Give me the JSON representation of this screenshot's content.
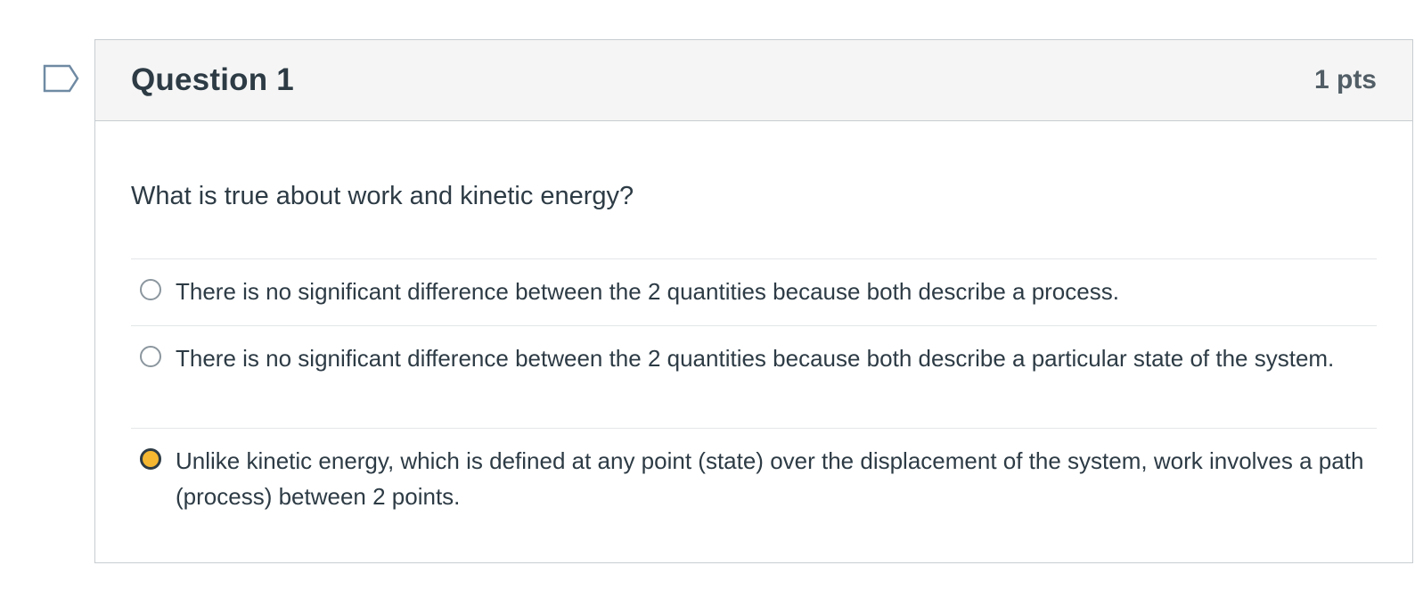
{
  "question": {
    "title": "Question 1",
    "points": "1 pts",
    "text": "What is true about work and kinetic energy?",
    "flag_icon": "flag-question-icon",
    "answers": [
      {
        "label": "There is no significant difference between the 2 quantities because both describe a process.",
        "selected": false
      },
      {
        "label": "There is no significant difference between the 2 quantities because both describe a particular state of the system.",
        "selected": false
      },
      {
        "label": "Unlike kinetic energy, which is defined at any point (state) over the displacement of the system, work involves a path (process) between 2 points.",
        "selected": true
      }
    ]
  },
  "colors": {
    "selected_radio_fill": "#f5b731",
    "header_background": "#f5f5f5",
    "text": "#2d3b45"
  }
}
